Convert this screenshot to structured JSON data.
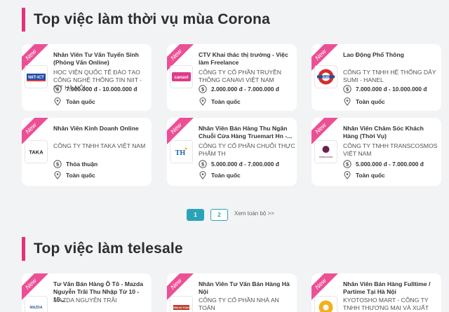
{
  "sections": [
    {
      "title": "Top việc làm thời vụ mùa Corona"
    },
    {
      "title": "Top việc làm telesale"
    }
  ],
  "badge": "New",
  "salary_icon": "dollar-circle-icon",
  "location_icon": "map-pin-icon",
  "cards": [
    {
      "title": "Nhân Viên Tư Vấn Tuyển Sinh (Phỏng Vấn Online)",
      "company": "Học Viện Quốc Tế Đào Tạo Công Nghệ Thông Tin NIIT - ICT Hà Nội",
      "salary": "7.000.000 đ - 10.000.000 đ",
      "location": "Toàn quốc",
      "logo_text": "NIIT-ICT",
      "logo_color": "#1e4aa8"
    },
    {
      "title": "CTV Khai thác thị trường - Việc làm Freelance",
      "company": "Công ty Cổ phần Truyền thông Canavi Việt Nam",
      "salary": "2.000.000 đ - 7.000.000 đ",
      "location": "Toàn quốc",
      "logo_text": "canavi",
      "logo_color": "#e0398a"
    },
    {
      "title": "Lao Động Phổ Thông",
      "company": "Công ty TNHH Hệ thống dây Sumi - Hanel",
      "salary": "7.000.000 đ - 10.000.000 đ",
      "location": "Toàn quốc",
      "logo_text": "SUMI",
      "logo_color": "#d32f2f"
    },
    {
      "title": "Nhân Viên Kinh Doanh Online",
      "company": "Công ty TNHH Taka Việt Nam",
      "salary": "Thỏa thuận",
      "location": "Toàn quốc",
      "logo_text": "TAKA",
      "logo_color": "#222222"
    },
    {
      "title": "Nhân Viên Bán Hàng Thu Ngân Chuỗi Cửa Hàng Truemart Hn -...",
      "company": "Công ty Cổ phần Chuỗi Thực phẩm TH",
      "salary": "5.000.000 đ - 7.000.000 đ",
      "location": "Toàn quốc",
      "logo_text": "TH",
      "logo_color": "#1b5fa8"
    },
    {
      "title": "Nhân Viên Chăm Sóc Khách Hàng (Thời Vụ)",
      "company": "Công ty TNHH Transcosmos Việt Nam",
      "salary": "5.000.000 đ - 7.000.000 đ",
      "location": "Toàn quốc",
      "logo_text": "transcosmos",
      "logo_color": "#6d1f4f"
    },
    {
      "title": "Tư Vấn Bán Hàng Ô Tô - Mazda Nguyễn Trãi Thu Nhập Từ 10 - 15...",
      "company": "Mazda Nguyễn Trãi",
      "logo_text": "MAZDA",
      "logo_color": "#355c9a"
    },
    {
      "title": "Nhân Viên Tư Vấn Bán Hàng Hà Nội",
      "company": "Công ty Cổ phần Nhà An Toàn",
      "logo_text": "NHA AN TOAN",
      "logo_color": "#c0392b"
    },
    {
      "title": "Nhân Viên Bán Hàng Fulltime / Partime Tại Hà Nội",
      "company": "Kyotosho Mart - Công ty TNHH Thương mại và Xuất nhập khẩu...",
      "logo_text": "",
      "logo_color": "#f2b11c"
    }
  ],
  "pagination": {
    "page1": "1",
    "page2": "2",
    "more": "Xem toàn bộ >>"
  },
  "colors": {
    "accent": "#e4327a",
    "pager_active": "#2aa3b8",
    "background": "#f2f3f5"
  }
}
